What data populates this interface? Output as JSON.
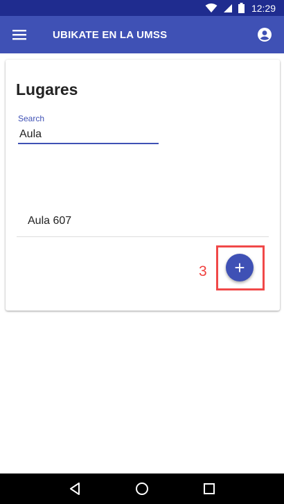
{
  "status_bar": {
    "time": "12:29",
    "icons": [
      "wifi-icon",
      "signal-icon",
      "battery-icon"
    ]
  },
  "app_bar": {
    "title": "UBIKATE EN LA UMSS",
    "menu_icon": "hamburger-menu-icon",
    "account_icon": "account-circle-icon"
  },
  "card": {
    "heading": "Lugares",
    "search": {
      "label": "Search",
      "value": "Aula"
    },
    "results": [
      {
        "label": "Aula 607"
      }
    ],
    "fab_label": "+",
    "annotation_number": "3"
  },
  "nav_bar": {
    "icons": [
      "back-icon",
      "home-icon",
      "recents-icon"
    ]
  },
  "colors": {
    "primary": "#3f51b5",
    "status_bar": "#1f2c8f",
    "annotation": "#f04848"
  }
}
